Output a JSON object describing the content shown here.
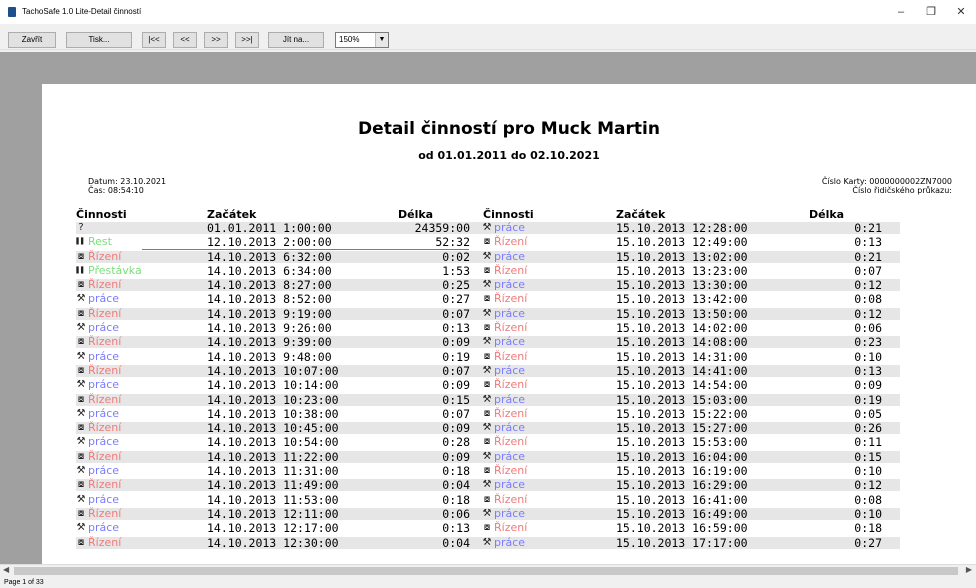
{
  "window": {
    "title": "TachoSafe 1.0 Lite-Detail činností"
  },
  "toolbar": {
    "close_label": "Zavřít",
    "print_label": "Tisk...",
    "first_label": "|<<",
    "prev_label": "<<",
    "next_label": ">>",
    "last_label": ">>|",
    "goto_label": "Jít na...",
    "zoom_value": "150%"
  },
  "report": {
    "title": "Detail činností pro Muck Martin",
    "subtitle": "od 01.01.2011 do 02.10.2021",
    "date": "Datum: 23.10.2021",
    "time": "Čas: 08:54:10",
    "card": "Číslo Karty: 0000000002ZN7000",
    "license": "Číslo řidičského průkazu:",
    "headers": {
      "activity": "Činnosti",
      "start": "Začátek",
      "length": "Délka"
    }
  },
  "colors": {
    "prace": "#7b7bff",
    "rizeni": "#f07a7a",
    "rest": "#7adf7a",
    "prestavka": "#7adf7a"
  },
  "left_rows": [
    {
      "icon": "unknown-icon",
      "activity": "",
      "type": "unknown",
      "start": "01.01.2011 1:00:00",
      "length": "24359:00"
    },
    {
      "icon": "rest-icon",
      "activity": "Rest",
      "type": "rest",
      "start": "12.10.2013 2:00:00",
      "length": "52:32"
    },
    {
      "icon": "driving-icon",
      "activity": "Řízení",
      "type": "rizeni",
      "start": "14.10.2013 6:32:00",
      "length": "0:02"
    },
    {
      "icon": "rest-icon",
      "activity": "Přestávka",
      "type": "prestavka",
      "start": "14.10.2013 6:34:00",
      "length": "1:53"
    },
    {
      "icon": "driving-icon",
      "activity": "Řízení",
      "type": "rizeni",
      "start": "14.10.2013 8:27:00",
      "length": "0:25"
    },
    {
      "icon": "work-icon",
      "activity": "práce",
      "type": "prace",
      "start": "14.10.2013 8:52:00",
      "length": "0:27"
    },
    {
      "icon": "driving-icon",
      "activity": "Řízení",
      "type": "rizeni",
      "start": "14.10.2013 9:19:00",
      "length": "0:07"
    },
    {
      "icon": "work-icon",
      "activity": "práce",
      "type": "prace",
      "start": "14.10.2013 9:26:00",
      "length": "0:13"
    },
    {
      "icon": "driving-icon",
      "activity": "Řízení",
      "type": "rizeni",
      "start": "14.10.2013 9:39:00",
      "length": "0:09"
    },
    {
      "icon": "work-icon",
      "activity": "práce",
      "type": "prace",
      "start": "14.10.2013 9:48:00",
      "length": "0:19"
    },
    {
      "icon": "driving-icon",
      "activity": "Řízení",
      "type": "rizeni",
      "start": "14.10.2013 10:07:00",
      "length": "0:07"
    },
    {
      "icon": "work-icon",
      "activity": "práce",
      "type": "prace",
      "start": "14.10.2013 10:14:00",
      "length": "0:09"
    },
    {
      "icon": "driving-icon",
      "activity": "Řízení",
      "type": "rizeni",
      "start": "14.10.2013 10:23:00",
      "length": "0:15"
    },
    {
      "icon": "work-icon",
      "activity": "práce",
      "type": "prace",
      "start": "14.10.2013 10:38:00",
      "length": "0:07"
    },
    {
      "icon": "driving-icon",
      "activity": "Řízení",
      "type": "rizeni",
      "start": "14.10.2013 10:45:00",
      "length": "0:09"
    },
    {
      "icon": "work-icon",
      "activity": "práce",
      "type": "prace",
      "start": "14.10.2013 10:54:00",
      "length": "0:28"
    },
    {
      "icon": "driving-icon",
      "activity": "Řízení",
      "type": "rizeni",
      "start": "14.10.2013 11:22:00",
      "length": "0:09"
    },
    {
      "icon": "work-icon",
      "activity": "práce",
      "type": "prace",
      "start": "14.10.2013 11:31:00",
      "length": "0:18"
    },
    {
      "icon": "driving-icon",
      "activity": "Řízení",
      "type": "rizeni",
      "start": "14.10.2013 11:49:00",
      "length": "0:04"
    },
    {
      "icon": "work-icon",
      "activity": "práce",
      "type": "prace",
      "start": "14.10.2013 11:53:00",
      "length": "0:18"
    },
    {
      "icon": "driving-icon",
      "activity": "Řízení",
      "type": "rizeni",
      "start": "14.10.2013 12:11:00",
      "length": "0:06"
    },
    {
      "icon": "work-icon",
      "activity": "práce",
      "type": "prace",
      "start": "14.10.2013 12:17:00",
      "length": "0:13"
    },
    {
      "icon": "driving-icon",
      "activity": "Řízení",
      "type": "rizeni",
      "start": "14.10.2013 12:30:00",
      "length": "0:04"
    }
  ],
  "right_rows": [
    {
      "icon": "work-icon",
      "activity": "práce",
      "type": "prace",
      "start": "15.10.2013 12:28:00",
      "length": "0:21"
    },
    {
      "icon": "driving-icon",
      "activity": "Řízení",
      "type": "rizeni",
      "start": "15.10.2013 12:49:00",
      "length": "0:13"
    },
    {
      "icon": "work-icon",
      "activity": "práce",
      "type": "prace",
      "start": "15.10.2013 13:02:00",
      "length": "0:21"
    },
    {
      "icon": "driving-icon",
      "activity": "Řízení",
      "type": "rizeni",
      "start": "15.10.2013 13:23:00",
      "length": "0:07"
    },
    {
      "icon": "work-icon",
      "activity": "práce",
      "type": "prace",
      "start": "15.10.2013 13:30:00",
      "length": "0:12"
    },
    {
      "icon": "driving-icon",
      "activity": "Řízení",
      "type": "rizeni",
      "start": "15.10.2013 13:42:00",
      "length": "0:08"
    },
    {
      "icon": "work-icon",
      "activity": "práce",
      "type": "prace",
      "start": "15.10.2013 13:50:00",
      "length": "0:12"
    },
    {
      "icon": "driving-icon",
      "activity": "Řízení",
      "type": "rizeni",
      "start": "15.10.2013 14:02:00",
      "length": "0:06"
    },
    {
      "icon": "work-icon",
      "activity": "práce",
      "type": "prace",
      "start": "15.10.2013 14:08:00",
      "length": "0:23"
    },
    {
      "icon": "driving-icon",
      "activity": "Řízení",
      "type": "rizeni",
      "start": "15.10.2013 14:31:00",
      "length": "0:10"
    },
    {
      "icon": "work-icon",
      "activity": "práce",
      "type": "prace",
      "start": "15.10.2013 14:41:00",
      "length": "0:13"
    },
    {
      "icon": "driving-icon",
      "activity": "Řízení",
      "type": "rizeni",
      "start": "15.10.2013 14:54:00",
      "length": "0:09"
    },
    {
      "icon": "work-icon",
      "activity": "práce",
      "type": "prace",
      "start": "15.10.2013 15:03:00",
      "length": "0:19"
    },
    {
      "icon": "driving-icon",
      "activity": "Řízení",
      "type": "rizeni",
      "start": "15.10.2013 15:22:00",
      "length": "0:05"
    },
    {
      "icon": "work-icon",
      "activity": "práce",
      "type": "prace",
      "start": "15.10.2013 15:27:00",
      "length": "0:26"
    },
    {
      "icon": "driving-icon",
      "activity": "Řízení",
      "type": "rizeni",
      "start": "15.10.2013 15:53:00",
      "length": "0:11"
    },
    {
      "icon": "work-icon",
      "activity": "práce",
      "type": "prace",
      "start": "15.10.2013 16:04:00",
      "length": "0:15"
    },
    {
      "icon": "driving-icon",
      "activity": "Řízení",
      "type": "rizeni",
      "start": "15.10.2013 16:19:00",
      "length": "0:10"
    },
    {
      "icon": "work-icon",
      "activity": "práce",
      "type": "prace",
      "start": "15.10.2013 16:29:00",
      "length": "0:12"
    },
    {
      "icon": "driving-icon",
      "activity": "Řízení",
      "type": "rizeni",
      "start": "15.10.2013 16:41:00",
      "length": "0:08"
    },
    {
      "icon": "work-icon",
      "activity": "práce",
      "type": "prace",
      "start": "15.10.2013 16:49:00",
      "length": "0:10"
    },
    {
      "icon": "driving-icon",
      "activity": "Řízení",
      "type": "rizeni",
      "start": "15.10.2013 16:59:00",
      "length": "0:18"
    },
    {
      "icon": "work-icon",
      "activity": "práce",
      "type": "prace",
      "start": "15.10.2013 17:17:00",
      "length": "0:27"
    }
  ],
  "status": {
    "page_info": "Page 1 of 33"
  }
}
